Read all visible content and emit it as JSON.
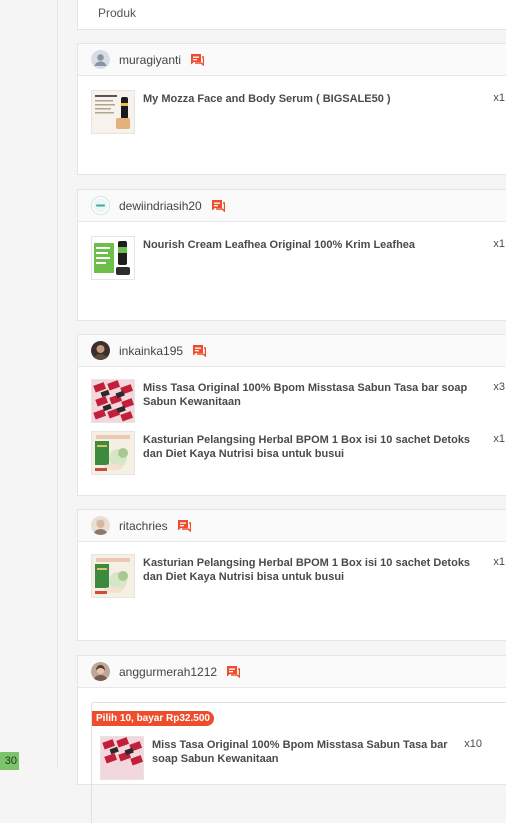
{
  "header": {
    "label": "Produk"
  },
  "left_rail": {
    "badge": "30"
  },
  "orders": [
    {
      "username": "muragiyanti",
      "avatar": "default-user-avatar",
      "items": [
        {
          "name": "My Mozza Face and Body Serum ( BIGSALE50 )",
          "qty": "x1",
          "thumb": "serum-product-thumb"
        }
      ]
    },
    {
      "username": "dewiindriasih20",
      "avatar": "brand-logo-avatar",
      "items": [
        {
          "name": "Nourish Cream Leafhea Original 100% Krim Leafhea",
          "qty": "x1",
          "thumb": "cream-product-thumb"
        }
      ]
    },
    {
      "username": "inkainka195",
      "avatar": "photo-avatar",
      "items": [
        {
          "name": "Miss Tasa Original 100% Bpom Misstasa Sabun Tasa bar soap Sabun Kewanitaan",
          "qty": "x3",
          "thumb": "soap-product-thumb"
        },
        {
          "name": "Kasturian Pelangsing Herbal BPOM 1 Box isi 10 sachet Detoks dan Diet Kaya Nutrisi bisa untuk busui",
          "qty": "x1",
          "thumb": "herbal-product-thumb"
        }
      ]
    },
    {
      "username": "ritachries",
      "avatar": "photo-avatar",
      "items": [
        {
          "name": "Kasturian Pelangsing Herbal BPOM 1 Box isi 10 sachet Detoks dan Diet Kaya Nutrisi bisa untuk busui",
          "qty": "x1",
          "thumb": "herbal-product-thumb"
        }
      ]
    },
    {
      "username": "anggurmerah1212",
      "avatar": "photo-avatar",
      "promo": "Pilih 10, bayar Rp32.500",
      "items": [
        {
          "name": "Miss Tasa Original 100% Bpom Misstasa Sabun Tasa bar soap Sabun Kewanitaan",
          "qty": "x10",
          "thumb": "soap-product-thumb"
        }
      ]
    }
  ],
  "colors": {
    "accent": "#ee4d2d",
    "chat_icon": "#ee4d2d",
    "badge_green": "#7cc36b"
  }
}
